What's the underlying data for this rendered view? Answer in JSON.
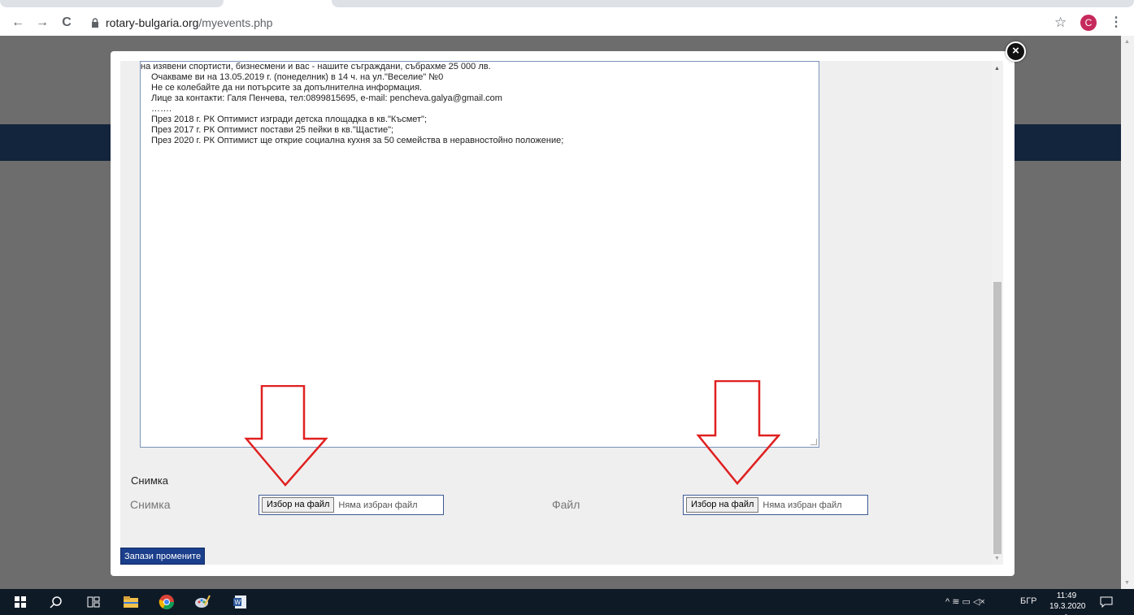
{
  "browser": {
    "url_host": "rotary-bulgaria.org",
    "url_path": "/myevents.php",
    "profile_initial": "C",
    "back_glyph": "←",
    "forward_glyph": "→",
    "reload_glyph": "C",
    "star_glyph": "☆",
    "menu_glyph": "⋮"
  },
  "modal": {
    "close_glyph": "×",
    "textarea_lines": [
      "на изявени спортисти, бизнесмени и вас - нашите съграждани, събрахме 25 000 лв.",
      "Очакваме ви на 13.05.2019 г. (понеделник) в 14 ч. на ул.\"Веселие\" №0",
      "Не се колебайте да ни потърсите за допълнителна информация.",
      "Лице за контакти: Галя Пенчева, тел:0899815695, e-mail: pencheva.galya@gmail.com",
      "…….",
      "През 2018 г. РК Оптимист изгради детска площадка в кв.\"Късмет\";",
      "През 2017 г. РК Оптимист постави 25 пейки в кв.\"Щастие\";",
      "През 2020 г. РК Оптимист ще открие социална кухня за 50 семейства в неравностойно положение;"
    ],
    "section_title": "Снимка",
    "photo_label": "Снимка",
    "file_label": "Файл",
    "choose_file_label": "Избор на файл",
    "no_file_label": "Няма избран файл",
    "save_label": "Запази промените"
  },
  "taskbar": {
    "time": "11:49",
    "date": "19.3.2020 г.",
    "language": "БГР",
    "tray_glyphs": "^  ≋  ▭  ◁×"
  },
  "colors": {
    "accent": "#1b3f8b",
    "arrow": "#e02020",
    "nav_band": "#13243d"
  }
}
